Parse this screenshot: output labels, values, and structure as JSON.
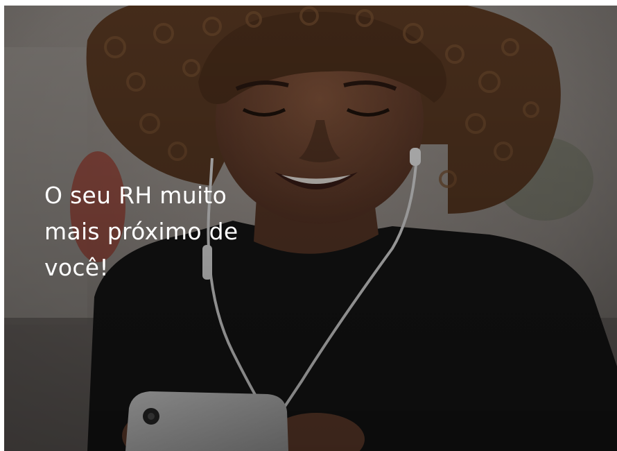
{
  "hero": {
    "headline": "O seu RH muito\nmais próximo de\nvocê!",
    "image": "smiling-woman-with-earphones-using-phone-photo"
  },
  "colors": {
    "overlay": "#2a2624",
    "headline_text": "#ffffff",
    "shirt": "#151515",
    "hair": "#5a3a22",
    "skin": "#6e4632"
  }
}
